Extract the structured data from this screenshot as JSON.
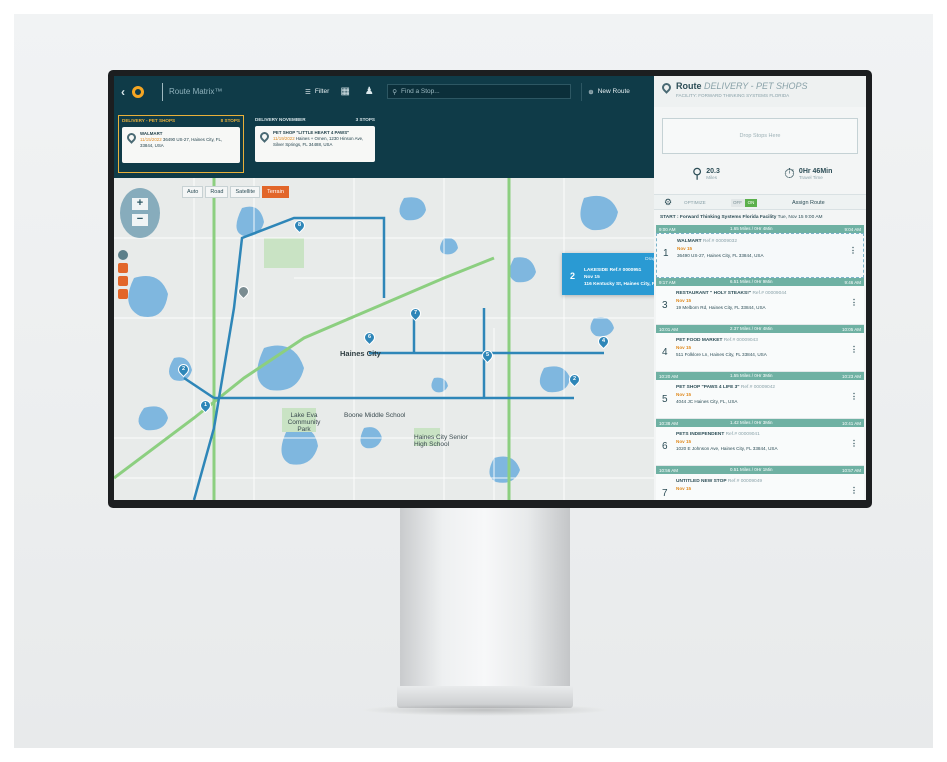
{
  "app": {
    "title": "Route Matrix™"
  },
  "toolbar": {
    "filter_label": "Filter",
    "search_placeholder": "Find a Stop...",
    "new_route_label": "New Route"
  },
  "routes": [
    {
      "name": "DELIVERY - PET SHOPS",
      "stops_count": "8 STOPS",
      "stop_name": "WALMART",
      "stop_date": "11/15/2022",
      "stop_address": "36490 US-27, Haines City, FL, 33844, USA",
      "active": true
    },
    {
      "name": "DELIVERY NOVEMBER",
      "stops_count": "3 STOPS",
      "stop_name": "PET SHOP \"LITTLE HEART 4 PAWS\"",
      "stop_date": "11/19/2022",
      "stop_address": "Haines + Omen, 1230 Hinson Ave, Silver Springs, FL 34488, USA",
      "active": false
    }
  ],
  "map": {
    "type_buttons": [
      "Auto",
      "Road",
      "Satellite",
      "Terrain"
    ],
    "selected_type": "Terrain",
    "zoom_in": "+",
    "zoom_out": "−",
    "labels": {
      "haines_city": "Haines City",
      "lake_eva": "Lake Eva Community Park",
      "boone": "Boone Middle School",
      "senior_high": "Haines City Senior High School"
    },
    "markers": [
      "1",
      "2",
      "4",
      "5",
      "6",
      "2",
      "7",
      "8",
      "4"
    ]
  },
  "drag_card": {
    "tip": "Drag to new position",
    "number": "2",
    "title": "LAKESIDE Ref.# 0000951",
    "date": "Nov 15",
    "address": "116 Kentucky St, Haines City, FL 33844, USA"
  },
  "panel": {
    "route_label": "Route",
    "route_name": "DELIVERY - PET SHOPS",
    "facility": "FACILITY: FORWARD THINKING SYSTEMS FLORIDA",
    "drop_text": "Drop Stops Here",
    "miles_value": "20.3",
    "miles_label": "Miles",
    "time_value": "0Hr 46Min",
    "time_label": "Travel Time",
    "optimize_label": "OPTIMIZE",
    "toggle_off": "OFF",
    "toggle_on": "ON",
    "assign_label": "Assign Route",
    "start_text": "START : Forward Thinking Systems Florida Facility",
    "start_time": "Tue, Nov 15 9:00 AM"
  },
  "stops": [
    {
      "seg_left": "9:00 AM",
      "seg_mid": "1.65 Miles / 0Hr 4Min",
      "seg_right": "9:04 AM",
      "number": "1",
      "name": "WALMART",
      "ref": "Ref.# 00009032",
      "date": "Nov 15",
      "address": "36490 US-27, Haines City, FL 33844, USA"
    },
    {
      "seg_left": "9:17 AM",
      "seg_mid": "6.51 Miles / 0Hr 9Min",
      "seg_right": "9:46 AM",
      "number": "3",
      "name": "RESTAURANT \" HOLY STEAKS!\"",
      "ref": "Ref.# 00009044",
      "date": "Nov 15",
      "address": "19 Melborn Rd, Haines City, FL 33844, USA"
    },
    {
      "seg_left": "10:01 AM",
      "seg_mid": "2.37 Miles / 0Hr 4Min",
      "seg_right": "10:05 AM",
      "number": "4",
      "name": "PET FOOD MARKET",
      "ref": "Ref.# 00009043",
      "date": "Nov 15",
      "address": "511 Folklore Ln, Haines City, FL 33844, USA"
    },
    {
      "seg_left": "10:20 AM",
      "seg_mid": "1.55 Miles / 0Hr 3Min",
      "seg_right": "10:23 AM",
      "number": "5",
      "name": "PET SHOP \"PAWS 4 LIFE 3\"",
      "ref": "Ref.# 00009042",
      "date": "Nov 15",
      "address": "4044 JC Haines City, FL, USA"
    },
    {
      "seg_left": "10:38 AM",
      "seg_mid": "1.42 Miles / 0Hr 3Min",
      "seg_right": "10:41 AM",
      "number": "6",
      "name": "PETS INDEPENDENT",
      "ref": "Ref.# 00009041",
      "date": "Nov 15",
      "address": "1020 E Johnson Ave, Haines City, FL 33844, USA"
    },
    {
      "seg_left": "10:56 AM",
      "seg_mid": "0.51 Miles / 0Hr 1Min",
      "seg_right": "10:57 AM",
      "number": "7",
      "name": "UNTITLED NEW STOP",
      "ref": "Ref.# 00009049",
      "date": "Nov 15",
      "address": ""
    }
  ],
  "colors": {
    "brand_dark": "#0f3b48",
    "accent_orange": "#e2662a",
    "route_blue": "#2e86b8",
    "segment_green": "#6fb1a3"
  }
}
